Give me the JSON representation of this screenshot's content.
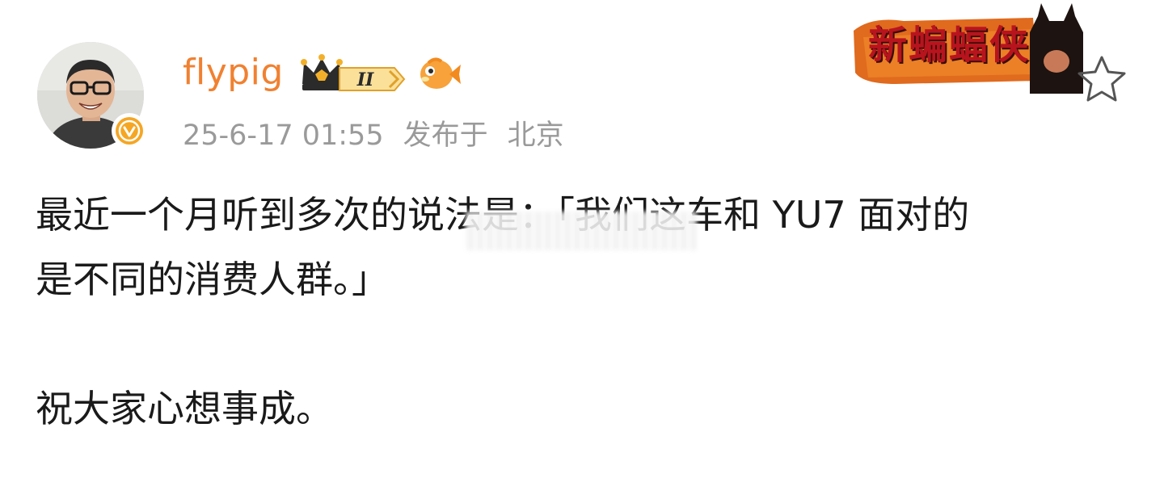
{
  "post": {
    "author": {
      "name": "flypig",
      "vip_level": "II"
    },
    "meta": {
      "time": "25-6-17 01:55",
      "location_prefix": "发布于",
      "location": "北京"
    },
    "decoration": {
      "title": "新蝙蝠侠"
    },
    "content": {
      "line1": "最近一个月听到多次的说法是：「我们这车和 YU7 面对的",
      "line2": "是不同的消费人群。」",
      "line3": "祝大家心想事成。"
    }
  },
  "colors": {
    "username": "#f08131",
    "meta": "#9a9a9a",
    "text": "#1a1a1a",
    "verified": "#f5a623",
    "crown": "#2b2b2b",
    "gold": "#f2b02a"
  },
  "icons": [
    "verified-icon",
    "crown-vip-icon",
    "fish-icon",
    "star-icon"
  ]
}
